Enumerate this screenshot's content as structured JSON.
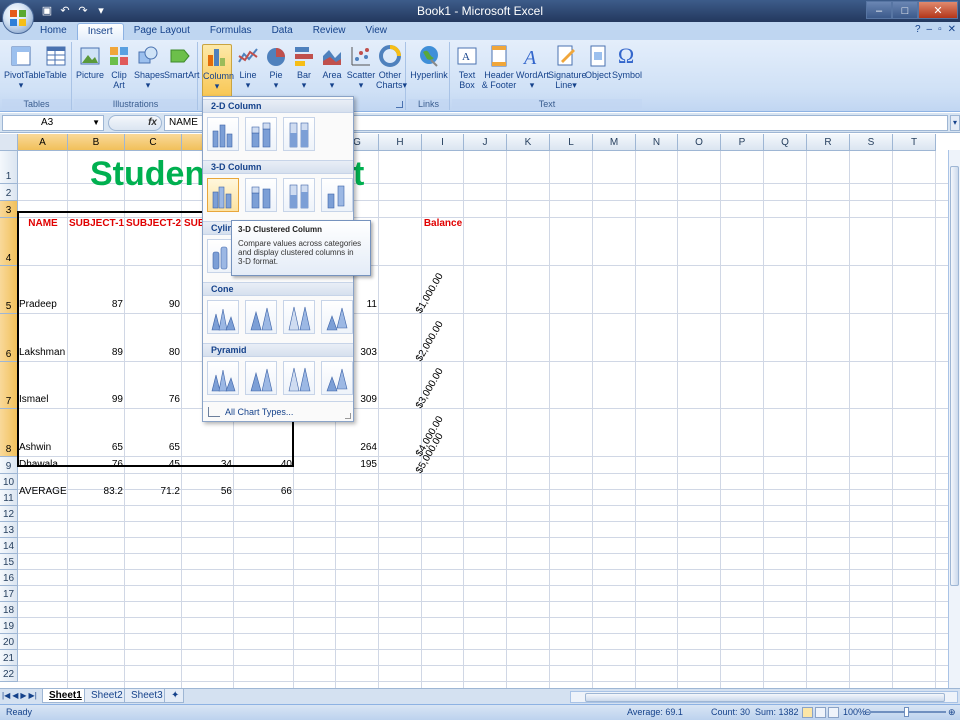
{
  "window": {
    "title": "Book1 - Microsoft Excel"
  },
  "tabs": [
    "Home",
    "Insert",
    "Page Layout",
    "Formulas",
    "Data",
    "Review",
    "View"
  ],
  "active_tab": "Insert",
  "ribbon": {
    "tables": {
      "label": "Tables",
      "pivottable": "PivotTable",
      "table": "Table"
    },
    "illustrations": {
      "label": "Illustrations",
      "picture": "Picture",
      "clipart_1": "Clip",
      "clipart_2": "Art",
      "shapes": "Shapes",
      "smartart": "SmartArt"
    },
    "charts": {
      "column": "Column",
      "line": "Line",
      "pie": "Pie",
      "bar": "Bar",
      "area": "Area",
      "scatter": "Scatter",
      "other_1": "Other",
      "other_2": "Charts"
    },
    "links": {
      "label": "Links",
      "hyperlink": "Hyperlink"
    },
    "text": {
      "label": "Text",
      "textbox_1": "Text",
      "textbox_2": "Box",
      "header_1": "Header",
      "header_2": "& Footer",
      "wordart": "WordArt",
      "signature_1": "Signature",
      "signature_2": "Line",
      "object": "Object",
      "symbol": "Symbol"
    }
  },
  "formula_bar": {
    "name_box": "A3",
    "fx": "fx",
    "content": "NAME"
  },
  "columns": [
    "A",
    "B",
    "C",
    "D",
    "E",
    "F",
    "G",
    "H",
    "I",
    "J",
    "K",
    "L",
    "M",
    "N",
    "O",
    "P",
    "Q",
    "R",
    "S",
    "T"
  ],
  "rows": [
    "1",
    "2",
    "3",
    "4",
    "5",
    "6",
    "7",
    "8",
    "9",
    "10",
    "11",
    "12",
    "13",
    "14",
    "15",
    "16",
    "17",
    "18",
    "19",
    "20",
    "21",
    "22"
  ],
  "sheet": {
    "title_left": "Studen",
    "title_right": "eet",
    "headers": {
      "name": "NAME",
      "s1": "SUBJECT-1",
      "s2": "SUBJECT-2",
      "s3": "SUB",
      "balance": "Balance"
    },
    "students": [
      {
        "name": "Pradeep",
        "s1": "87",
        "s2": "90",
        "s3": "",
        "s4": "",
        "g": "11",
        "balance": "$1,000.00"
      },
      {
        "name": "Lakshman",
        "s1": "89",
        "s2": "80",
        "s3": "",
        "s4": "",
        "g": "303",
        "balance": "$2,000.00"
      },
      {
        "name": "Ismael",
        "s1": "99",
        "s2": "76",
        "s3": "",
        "s4": "",
        "g": "309",
        "balance": "$3,000.00"
      },
      {
        "name": "Ashwin",
        "s1": "65",
        "s2": "65",
        "s3": "",
        "s4": "",
        "g": "264",
        "balance": "$4,000.00"
      },
      {
        "name": "Dhawala",
        "s1": "76",
        "s2": "45",
        "s3": "34",
        "s4": "40",
        "g": "195",
        "balance": "$5,000.00"
      }
    ],
    "average": {
      "label": "AVERAGE",
      "s1": "83.2",
      "s2": "71.2",
      "s3": "56",
      "s4": "66"
    }
  },
  "chart_menu": {
    "sections": {
      "col2d": "2-D Column",
      "col3d": "3-D Column",
      "cylinder": "Cylinc",
      "cone": "Cone",
      "pyramid": "Pyramid"
    },
    "all_types": "All Chart Types..."
  },
  "tooltip": {
    "title": "3-D Clustered Column",
    "line1": "Compare values across categories",
    "line2": "and display clustered columns in",
    "line3": "3-D format."
  },
  "sheet_tabs": [
    "Sheet1",
    "Sheet2",
    "Sheet3"
  ],
  "status": {
    "ready": "Ready",
    "average": "Average: 69.1",
    "count": "Count: 30",
    "sum": "Sum: 1382",
    "zoom": "100%"
  }
}
